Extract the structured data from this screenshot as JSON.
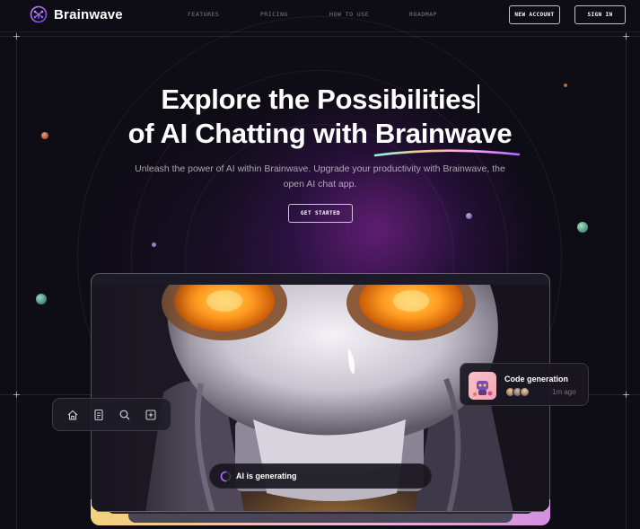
{
  "brand": {
    "name": "Brainwave",
    "logo_icon": "brain-circuit-icon",
    "accent": "#ac6aff"
  },
  "nav": {
    "items": [
      "FEATURES",
      "PRICING",
      "HOW TO USE",
      "ROADMAP"
    ],
    "new_account_label": "NEW ACCOUNT",
    "sign_in_label": "SIGN IN"
  },
  "hero": {
    "title_line1": "Explore the Possibilities",
    "title_line2_prefix": "of AI Chatting with ",
    "title_line2_highlight": "Brainwave",
    "subtitle": "Unleash the power of AI within Brainwave. Upgrade your productivity with Brainwave, the open AI chat app.",
    "cta_label": "GET STARTED"
  },
  "toolbar": {
    "icons": [
      "home-icon",
      "document-icon",
      "search-icon",
      "plus-square-icon"
    ]
  },
  "code_card": {
    "title": "Code generation",
    "time": "1m ago",
    "thumb_icon": "robot-thumbnail-icon"
  },
  "generating": {
    "text": "AI is generating",
    "icon": "spinner-icon"
  },
  "colors": {
    "background": "#0e0c15",
    "glow": "#9628aa",
    "robot_eyes": "#ff9a1f"
  }
}
